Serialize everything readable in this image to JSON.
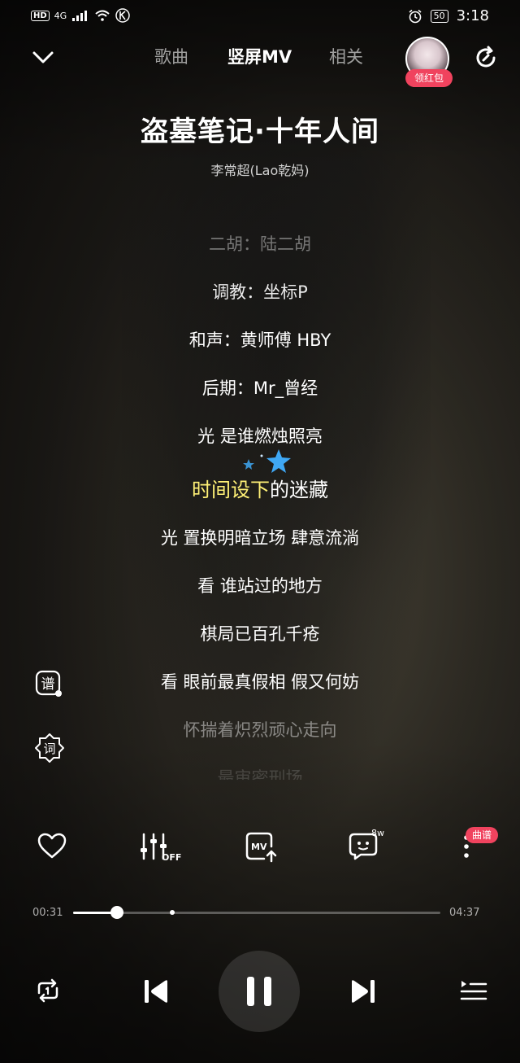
{
  "status_bar": {
    "left_labels": [
      "HD",
      "4G"
    ],
    "battery": "50",
    "time": "3:18"
  },
  "header": {
    "tabs": [
      {
        "label": "歌曲",
        "active": false
      },
      {
        "label": "竖屏MV",
        "active": true
      },
      {
        "label": "相关",
        "active": false
      }
    ],
    "avatar_badge": "领红包"
  },
  "song": {
    "title": "盗墓笔记·十年人间",
    "artist": "李常超(Lao乾妈)"
  },
  "lyrics": {
    "lines": [
      "二胡：陆二胡",
      "调教：坐标P",
      "和声：黄师傅 HBY",
      "后期：Mr_曾经",
      "光 是谁燃烛照亮",
      "时间设下的迷藏",
      "光 置换明暗立场 肆意流淌",
      "看 谁站过的地方",
      "棋局已百孔千疮",
      "看 眼前最真假相 假又何妨",
      "怀揣着炽烈顽心走向",
      "最审密刑场"
    ],
    "current_index": 5,
    "current_sung": "时间设下",
    "current_rest": "的迷藏"
  },
  "side_icons": [
    "score-icon",
    "lyric-icon"
  ],
  "side_labels": {
    "score": "谱",
    "lyric": "词"
  },
  "actions": {
    "comment_count": "8w",
    "more_badge": "曲谱",
    "eq_label": "OFF",
    "mv_label": "MV"
  },
  "progress": {
    "current_time": "00:31",
    "total_time": "04:37",
    "fraction": 0.12,
    "marker_fraction": 0.27
  },
  "colors": {
    "accent_red": "#f0435e",
    "lyric_highlight": "#fff176"
  }
}
